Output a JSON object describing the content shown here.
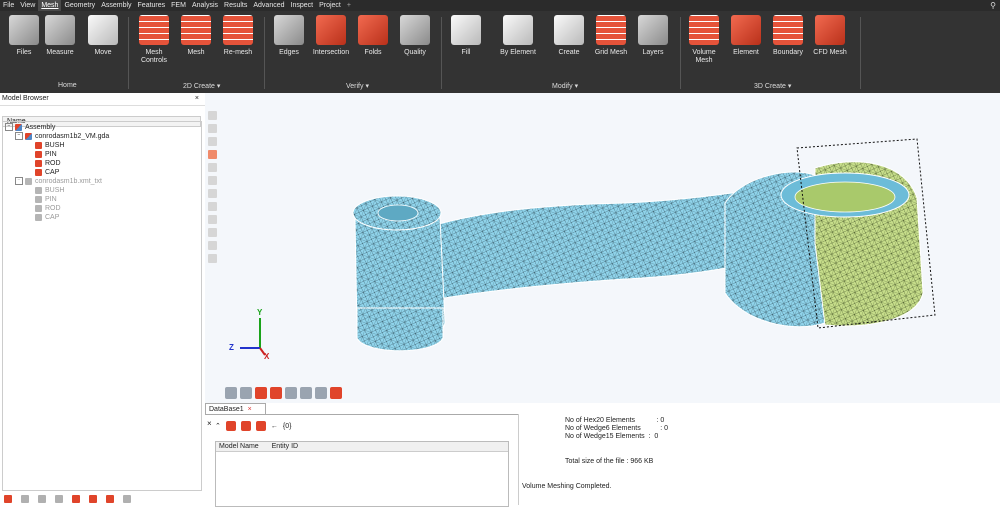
{
  "menubar": {
    "items": [
      "File",
      "View",
      "Mesh",
      "Geometry",
      "Assembly",
      "Features",
      "FEM",
      "Analysis",
      "Results",
      "Advanced",
      "Inspect",
      "Project"
    ],
    "active": "Mesh",
    "plus": "+"
  },
  "ribbon": {
    "tools": [
      {
        "label": "Files"
      },
      {
        "label": "Measure"
      },
      {
        "label": "Move"
      },
      {
        "label": "Mesh\nControls"
      },
      {
        "label": "Mesh"
      },
      {
        "label": "Re-mesh"
      },
      {
        "label": "Edges"
      },
      {
        "label": "Intersection"
      },
      {
        "label": "Folds"
      },
      {
        "label": "Quality"
      },
      {
        "label": "Fill"
      },
      {
        "label": "By Element"
      },
      {
        "label": "Create"
      },
      {
        "label": "Grid Mesh"
      },
      {
        "label": "Layers"
      },
      {
        "label": "Volume\nMesh"
      },
      {
        "label": "Element"
      },
      {
        "label": "Boundary"
      },
      {
        "label": "CFD Mesh"
      }
    ],
    "groups": [
      "Home",
      "2D Create",
      "Verify",
      "Modify",
      "3D Create"
    ],
    "dropdown_glyph": "▾"
  },
  "model_browser": {
    "title": "Model Browser",
    "close": "×",
    "column": "Name",
    "tree": {
      "root": "Assembly",
      "file1": {
        "name": "conrodasm1b2_VM.gda",
        "parts": [
          "BUSH",
          "PIN",
          "ROD",
          "CAP"
        ]
      },
      "file2": {
        "name": "conrodasm1b.xmt_txt",
        "parts": [
          "BUSH",
          "PIN",
          "ROD",
          "CAP"
        ]
      }
    }
  },
  "triad": {
    "x": "X",
    "y": "Y",
    "z": "Z"
  },
  "database": {
    "tab": "DataBase1",
    "tab_close": "×",
    "panel_close": "×",
    "count": "{0}",
    "columns": [
      "Model Name",
      "Entity ID"
    ]
  },
  "log": {
    "lines": [
      "No of Hex20 Elements           : 0",
      "No of Wedge6 Elements          : 0",
      "No of Wedge15 Elements  :  0",
      "Total size of the file : 966 KB",
      "Volume Meshing Completed."
    ]
  },
  "colors": {
    "mesh_blue": "#8fd3ea",
    "mesh_green": "#c6dd8a",
    "accent_red": "#e0442a",
    "ribbon_bg": "#333333"
  }
}
